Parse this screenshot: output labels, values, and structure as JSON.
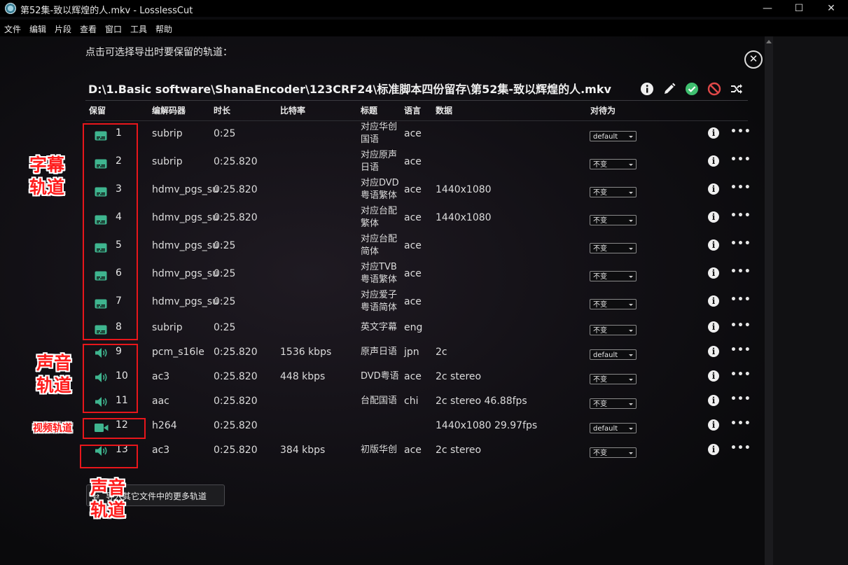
{
  "window": {
    "title": "第52集-致以辉煌的人.mkv - LosslessCut",
    "controls": {
      "minimize": "—",
      "maximize": "☐",
      "close": "✕"
    }
  },
  "menu": [
    "文件",
    "编辑",
    "片段",
    "查看",
    "窗口",
    "工具",
    "帮助"
  ],
  "dialog": {
    "instruction": "点击可选择导出时要保留的轨道：",
    "close_glyph": "✕",
    "file_path": "D:\\1.Basic software\\ShanaEncoder\\123CRF24\\标准脚本四份留存\\第52集-致以辉煌的人.mkv",
    "toolbar_icons": [
      "info-icon",
      "edit-pencil-icon",
      "keep-all-check-icon",
      "discard-all-ban-icon",
      "shuffle-icon"
    ],
    "columns": {
      "keep": "保留",
      "codec": "编解码器",
      "duration": "时长",
      "bitrate": "比特率",
      "title": "标题",
      "lang": "语言",
      "data": "数据",
      "disposition": "对待为"
    },
    "tracks": [
      {
        "kind": "subtitle",
        "num": "1",
        "codec": "subrip",
        "duration": "0:25",
        "bitrate": "",
        "title": "对应华创国语",
        "lang": "ace",
        "data": "",
        "disposition": "default"
      },
      {
        "kind": "subtitle",
        "num": "2",
        "codec": "subrip",
        "duration": "0:25.820",
        "bitrate": "",
        "title": "对应原声日语",
        "lang": "ace",
        "data": "",
        "disposition": "不变"
      },
      {
        "kind": "subtitle",
        "num": "3",
        "codec": "hdmv_pgs_su",
        "duration": "0:25.820",
        "bitrate": "",
        "title": "对应DVD粤语繁体",
        "lang": "ace",
        "data": "1440x1080",
        "disposition": "不变"
      },
      {
        "kind": "subtitle",
        "num": "4",
        "codec": "hdmv_pgs_su",
        "duration": "0:25.820",
        "bitrate": "",
        "title": "对应台配繁体",
        "lang": "ace",
        "data": "1440x1080",
        "disposition": "不变"
      },
      {
        "kind": "subtitle",
        "num": "5",
        "codec": "hdmv_pgs_su",
        "duration": "0:25",
        "bitrate": "",
        "title": "对应台配简体",
        "lang": "ace",
        "data": "",
        "disposition": "不变"
      },
      {
        "kind": "subtitle",
        "num": "6",
        "codec": "hdmv_pgs_su",
        "duration": "0:25",
        "bitrate": "",
        "title": "对应TVB粤语繁体",
        "lang": "ace",
        "data": "",
        "disposition": "不变"
      },
      {
        "kind": "subtitle",
        "num": "7",
        "codec": "hdmv_pgs_su",
        "duration": "0:25",
        "bitrate": "",
        "title": "对应爱子粤语简体",
        "lang": "ace",
        "data": "",
        "disposition": "不变"
      },
      {
        "kind": "subtitle",
        "num": "8",
        "codec": "subrip",
        "duration": "0:25",
        "bitrate": "",
        "title": "英文字幕",
        "lang": "eng",
        "data": "",
        "disposition": "不变"
      },
      {
        "kind": "audio",
        "num": "9",
        "codec": "pcm_s16le",
        "duration": "0:25.820",
        "bitrate": "1536 kbps",
        "title": "原声日语",
        "lang": "jpn",
        "data": "2c",
        "disposition": "default"
      },
      {
        "kind": "audio",
        "num": "10",
        "codec": "ac3",
        "duration": "0:25.820",
        "bitrate": "448 kbps",
        "title": "DVD粤语",
        "lang": "ace",
        "data": "2c stereo",
        "disposition": "不变"
      },
      {
        "kind": "audio",
        "num": "11",
        "codec": "aac",
        "duration": "0:25.820",
        "bitrate": "",
        "title": "台配国语",
        "lang": "chi",
        "data": "2c stereo 46.88fps",
        "disposition": "不变"
      },
      {
        "kind": "video",
        "num": "12",
        "codec": "h264",
        "duration": "0:25.820",
        "bitrate": "",
        "title": "",
        "lang": "",
        "data": "1440x1080 29.97fps",
        "disposition": "default"
      },
      {
        "kind": "audio",
        "num": "13",
        "codec": "ac3",
        "duration": "0:25.820",
        "bitrate": "384 kbps",
        "title": "初版华创",
        "lang": "ace",
        "data": "2c stereo",
        "disposition": "不变"
      }
    ],
    "import_button": "导入其它文件中的更多轨道"
  },
  "annotations": {
    "subtitle_tracks": "字幕\n轨道",
    "audio_tracks": "声音\n轨道",
    "video_track": "视频轨道",
    "audio_track_bottom": "声音\n轨道"
  },
  "colors": {
    "accent_green": "#3fb58f",
    "annotation_red": "#e8161b",
    "ok_green": "#3fbf6f",
    "ban_red": "#e04848"
  }
}
